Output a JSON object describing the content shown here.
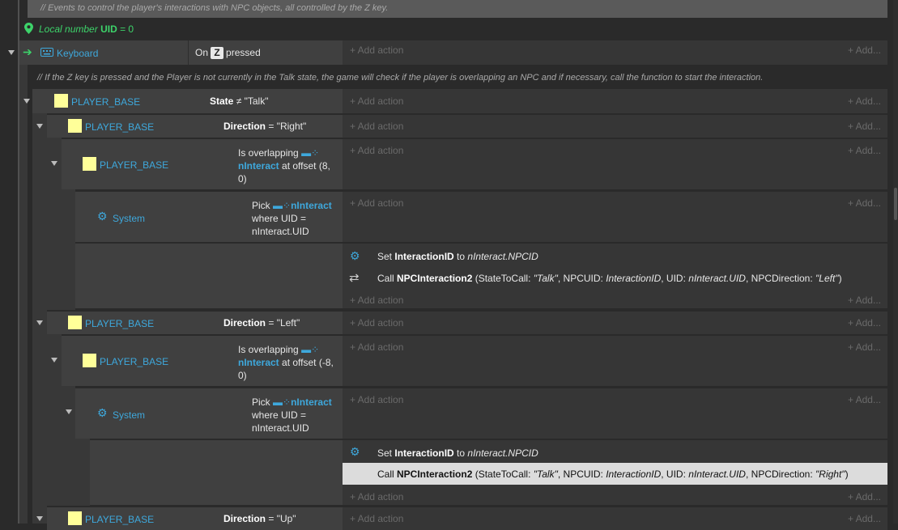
{
  "comments": {
    "top": "//  Events to control the player's interactions with NPC objects, all controlled by the Z key.",
    "mid": "//  If the Z key is pressed and the Player is not currently in the Talk state, the game will check if the player is overlapping an NPC and if necessary, call the function to start the interaction."
  },
  "local_var": {
    "prefix": "Local number",
    "name": "UID",
    "suffix": "= 0"
  },
  "keyboard_event": {
    "object": "Keyboard",
    "on": "On",
    "key": "Z",
    "pressed": "pressed"
  },
  "labels": {
    "add_action": "+ Add action",
    "add_short": "+ Add...",
    "player_base": "PLAYER_BASE",
    "system": "System"
  },
  "conditions": {
    "state": {
      "prefix": "State",
      "value": "≠ \"Talk\""
    },
    "dir_right": {
      "prefix": "Direction",
      "value": "= \"Right\""
    },
    "dir_left": {
      "prefix": "Direction",
      "value": "= \"Left\""
    },
    "dir_up": {
      "prefix": "Direction",
      "value": "= \"Up\""
    },
    "overlap_right": {
      "l1": "Is overlapping",
      "obj": "nInteract",
      "l2": "at offset (8,",
      "l3": "0)"
    },
    "overlap_left": {
      "l1": "Is overlapping",
      "obj": "nInteract",
      "l2": "at offset (-8,",
      "l3": "0)"
    },
    "pick": {
      "l1": "Pick",
      "obj": "nInteract",
      "l2": "where UID =",
      "l3": "nInteract.UID"
    }
  },
  "actions": {
    "set_id": {
      "pre": "Set",
      "var": "InteractionID",
      "mid": "to",
      "val": "nInteract.NPCID"
    },
    "call_right": {
      "pre": "Call",
      "fn": "NPCInteraction2",
      "p1": "(StateToCall:",
      "p1v": "\"Talk\"",
      "p2": ", NPCUID:",
      "p2v": "InteractionID",
      "p3": ", UID:",
      "p3v": "nInteract.UID",
      "p4": ", NPCDirection:",
      "p4v": "\"Left\"",
      "end": ")"
    },
    "call_left": {
      "pre": "Call",
      "fn": "NPCInteraction2",
      "p1": "(StateToCall:",
      "p1v": "\"Talk\"",
      "p2": ", NPCUID:",
      "p2v": "InteractionID",
      "p3": ", UID:",
      "p3v": "nInteract.UID",
      "p4": ", NPCDirection:",
      "p4v": "\"Right\"",
      "end": ")"
    }
  },
  "colors": {
    "accent": "#3ea8dc",
    "object_square": "#ffff99",
    "local_var": "#3dd36a"
  }
}
